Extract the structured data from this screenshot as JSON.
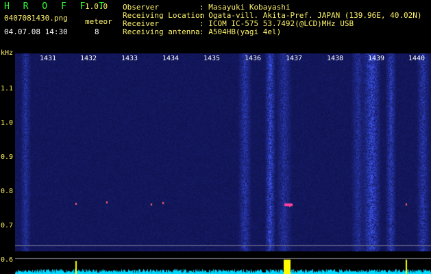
{
  "header": {
    "app_title": "H R O F F T",
    "version": "1.0.0",
    "filename": "0407081430.png",
    "timestamp": "04.07.08 14:30",
    "meteor_label": "meteor",
    "meteor_count": "8",
    "info": [
      {
        "label": "Observer",
        "value": ": Masayuki Kobayashi"
      },
      {
        "label": "Receiving Location",
        "value": ": Ogata-vill. Akita-Pref. JAPAN (139.96E, 40.02N)"
      },
      {
        "label": "Receiver",
        "value": ": ICOM IC-575 53.7492(@LCD)MHz USB"
      },
      {
        "label": "Receiving antenna",
        "value": ": A504HB(yagi 4el)"
      }
    ]
  },
  "axes": {
    "y_unit": "kHz",
    "y_ticks": [
      "1.1",
      "1.0",
      "0.9",
      "0.8",
      "0.7",
      "0.6"
    ],
    "x_ticks": [
      "1431",
      "1432",
      "1433",
      "1434",
      "1435",
      "1436",
      "1437",
      "1438",
      "1439",
      "1440"
    ]
  },
  "colors": {
    "background": "#000000",
    "label_yellow": "#fff36a",
    "title_green": "#33ff33",
    "spectrogram_base": "#0a0a40",
    "spectrum_cyan": "#00e0ff",
    "spectrum_peak": "#ffff00"
  }
}
